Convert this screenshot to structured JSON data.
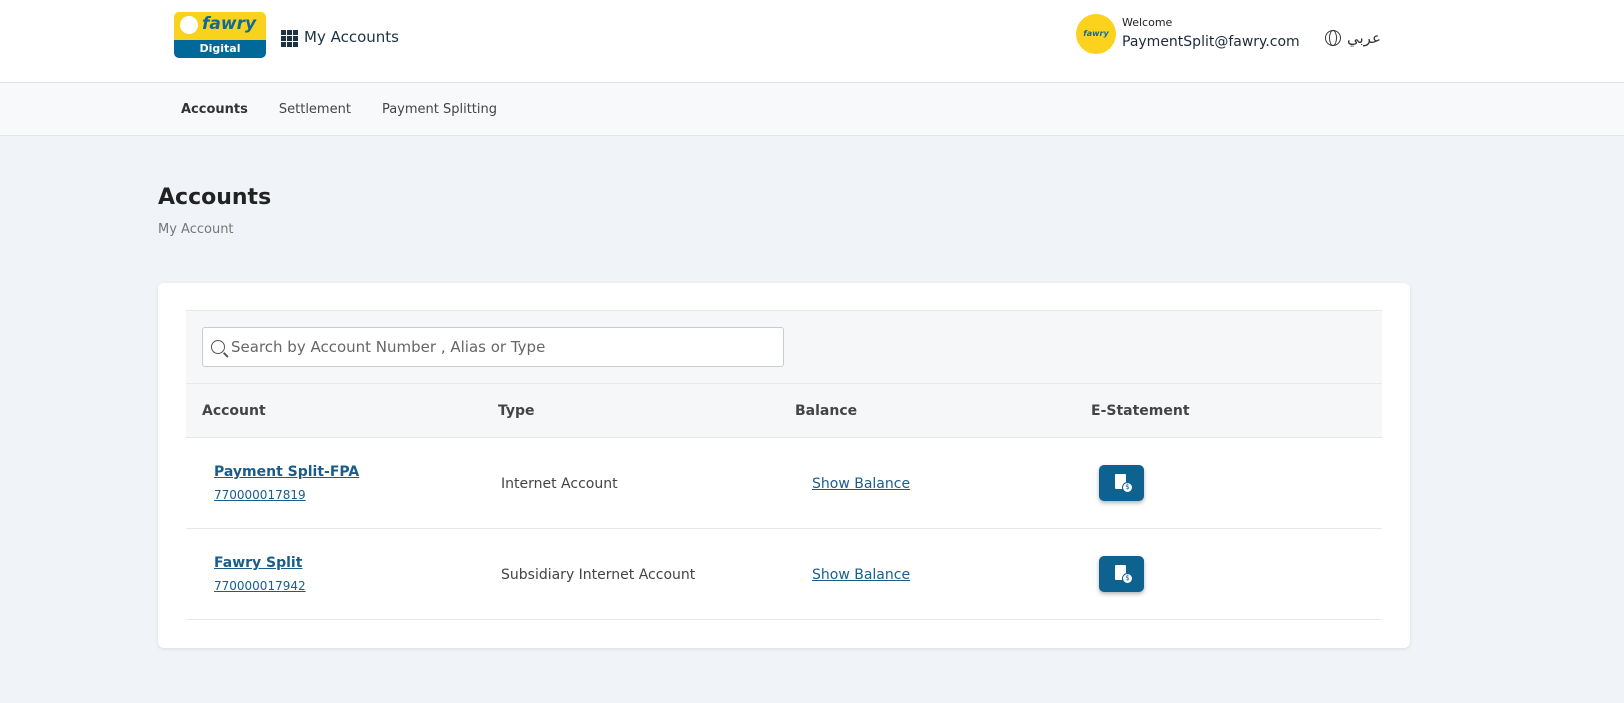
{
  "header": {
    "logo_top": "fawry",
    "logo_bottom": "Digital",
    "app_title": "My Accounts",
    "avatar_text": "fawry",
    "welcome": "Welcome",
    "email": "PaymentSplit@fawry.com",
    "language": "عربي"
  },
  "nav": [
    "Accounts",
    "Settlement",
    "Payment Splitting"
  ],
  "page": {
    "title": "Accounts",
    "breadcrumb": "My Account"
  },
  "search": {
    "placeholder": "Search by Account Number , Alias or Type",
    "value": ""
  },
  "table": {
    "headers": [
      "Account",
      "Type",
      "Balance",
      "E-Statement"
    ],
    "rows": [
      {
        "alias": "Payment Split-FPA",
        "number": "770000017819",
        "type": "Internet Account",
        "balance": "Show Balance"
      },
      {
        "alias": "Fawry Split",
        "number": "770000017942",
        "type": "Subsidiary Internet Account",
        "balance": "Show Balance"
      }
    ]
  }
}
